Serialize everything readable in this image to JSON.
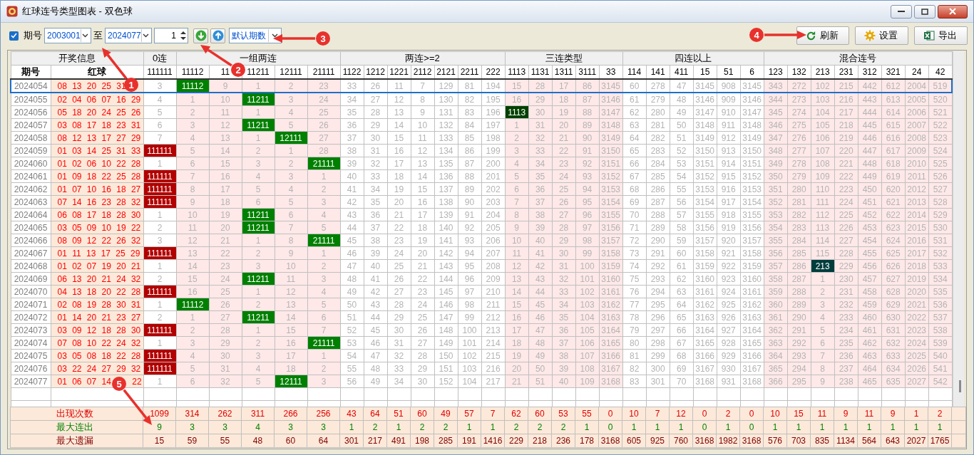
{
  "window": {
    "title": "红球连号类型图表 - 双色球"
  },
  "toolbar": {
    "range_toggle": {
      "label": "期号",
      "checked": true
    },
    "from": {
      "value": "2003001"
    },
    "to_label": "至",
    "to": {
      "value": "2024077"
    },
    "step": {
      "value": "1"
    },
    "preset": {
      "value": "默认期数"
    },
    "buttons": [
      {
        "label": "刷新",
        "kind": "refresh"
      },
      {
        "label": "设置",
        "kind": "settings"
      },
      {
        "label": "导出",
        "kind": "export"
      }
    ]
  },
  "table": {
    "info_header": {
      "title": "开奖信息",
      "columns": [
        "期号",
        "红球"
      ]
    },
    "groups": [
      {
        "title": "0连",
        "shaded": false,
        "columns": [
          "111111"
        ]
      },
      {
        "title": "一组两连",
        "shaded": true,
        "columns": [
          "11112",
          "11",
          "11211",
          "12111",
          "21111"
        ]
      },
      {
        "title": "两连>=2",
        "shaded": false,
        "columns": [
          "1122",
          "1212",
          "1221",
          "2112",
          "2121",
          "2211",
          "222"
        ]
      },
      {
        "title": "三连类型",
        "shaded": true,
        "columns": [
          "1113",
          "1131",
          "1311",
          "3111",
          "33"
        ]
      },
      {
        "title": "四连以上",
        "shaded": false,
        "columns": [
          "114",
          "141",
          "411",
          "15",
          "51",
          "6"
        ]
      },
      {
        "title": "混合连号",
        "shaded": true,
        "columns": [
          "123",
          "132",
          "213",
          "231",
          "312",
          "321",
          "24",
          "42"
        ]
      }
    ],
    "rows": [
      {
        "issue": "2024054",
        "balls": "08 13 20 25 31",
        "selected": true,
        "cells": [
          "3",
          {
            "text": "11112",
            "color": "#008000"
          },
          "9",
          "1",
          "2",
          "23",
          "33",
          "26",
          "11",
          "7",
          "129",
          "81",
          "194",
          "15",
          "28",
          "17",
          "86",
          "3145",
          "60",
          "278",
          "47",
          "3145",
          "908",
          "3145",
          "343",
          "272",
          "102",
          "215",
          "442",
          "612",
          "2004",
          "519"
        ]
      },
      {
        "issue": "2024055",
        "balls": "02 04 06 07 16 29",
        "selected": false,
        "cells": [
          "4",
          "1",
          "10",
          {
            "text": "11211",
            "color": "#008000"
          },
          "3",
          "24",
          "34",
          "27",
          "12",
          "8",
          "130",
          "82",
          "195",
          "16",
          "29",
          "18",
          "87",
          "3146",
          "61",
          "279",
          "48",
          "3146",
          "909",
          "3146",
          "344",
          "273",
          "103",
          "216",
          "443",
          "613",
          "2005",
          "520"
        ]
      },
      {
        "issue": "2024056",
        "balls": "05 18 20 24 25 26",
        "selected": false,
        "cells": [
          "5",
          "2",
          "11",
          "1",
          "4",
          "25",
          "35",
          "28",
          "13",
          "9",
          "131",
          "83",
          "196",
          {
            "text": "1113",
            "color": "#004000"
          },
          "30",
          "19",
          "88",
          "3147",
          "62",
          "280",
          "49",
          "3147",
          "910",
          "3147",
          "345",
          "274",
          "104",
          "217",
          "444",
          "614",
          "2006",
          "521"
        ]
      },
      {
        "issue": "2024057",
        "balls": "03 08 17 18 23 31",
        "selected": false,
        "cells": [
          "6",
          "3",
          "12",
          {
            "text": "11211",
            "color": "#008000"
          },
          "5",
          "26",
          "36",
          "29",
          "14",
          "10",
          "132",
          "84",
          "197",
          "1",
          "31",
          "20",
          "89",
          "3148",
          "63",
          "281",
          "50",
          "3148",
          "911",
          "3148",
          "346",
          "275",
          "105",
          "218",
          "445",
          "615",
          "2007",
          "522"
        ]
      },
      {
        "issue": "2024058",
        "balls": "08 12 13 17 27 29",
        "selected": false,
        "cells": [
          "7",
          "4",
          "13",
          "1",
          {
            "text": "12111",
            "color": "#008000"
          },
          "27",
          "37",
          "30",
          "15",
          "11",
          "133",
          "85",
          "198",
          "2",
          "32",
          "21",
          "90",
          "3149",
          "64",
          "282",
          "51",
          "3149",
          "912",
          "3149",
          "347",
          "276",
          "106",
          "219",
          "446",
          "616",
          "2008",
          "523"
        ]
      },
      {
        "issue": "2024059",
        "balls": "01 03 14 25 31 33",
        "selected": false,
        "cells": [
          {
            "text": "111111",
            "color": "#b20000"
          },
          "5",
          "14",
          "2",
          "1",
          "28",
          "38",
          "31",
          "16",
          "12",
          "134",
          "86",
          "199",
          "3",
          "33",
          "22",
          "91",
          "3150",
          "65",
          "283",
          "52",
          "3150",
          "913",
          "3150",
          "348",
          "277",
          "107",
          "220",
          "447",
          "617",
          "2009",
          "524"
        ]
      },
      {
        "issue": "2024060",
        "balls": "01 02 06 10 22 28",
        "selected": false,
        "cells": [
          "1",
          "6",
          "15",
          "3",
          "2",
          {
            "text": "21111",
            "color": "#008000"
          },
          "39",
          "32",
          "17",
          "13",
          "135",
          "87",
          "200",
          "4",
          "34",
          "23",
          "92",
          "3151",
          "66",
          "284",
          "53",
          "3151",
          "914",
          "3151",
          "349",
          "278",
          "108",
          "221",
          "448",
          "618",
          "2010",
          "525"
        ]
      },
      {
        "issue": "2024061",
        "balls": "01 09 18 22 25 28",
        "selected": false,
        "cells": [
          {
            "text": "111111",
            "color": "#b20000"
          },
          "7",
          "16",
          "4",
          "3",
          "1",
          "40",
          "33",
          "18",
          "14",
          "136",
          "88",
          "201",
          "5",
          "35",
          "24",
          "93",
          "3152",
          "67",
          "285",
          "54",
          "3152",
          "915",
          "3152",
          "350",
          "279",
          "109",
          "222",
          "449",
          "619",
          "2011",
          "526"
        ]
      },
      {
        "issue": "2024062",
        "balls": "01 07 10 16 18 27",
        "selected": false,
        "cells": [
          {
            "text": "111111",
            "color": "#b20000"
          },
          "8",
          "17",
          "5",
          "4",
          "2",
          "41",
          "34",
          "19",
          "15",
          "137",
          "89",
          "202",
          "6",
          "36",
          "25",
          "94",
          "3153",
          "68",
          "286",
          "55",
          "3153",
          "916",
          "3153",
          "351",
          "280",
          "110",
          "223",
          "450",
          "620",
          "2012",
          "527"
        ]
      },
      {
        "issue": "2024063",
        "balls": "07 14 16 23 28 32",
        "selected": false,
        "cells": [
          {
            "text": "111111",
            "color": "#b20000"
          },
          "9",
          "18",
          "6",
          "5",
          "3",
          "42",
          "35",
          "20",
          "16",
          "138",
          "90",
          "203",
          "7",
          "37",
          "26",
          "95",
          "3154",
          "69",
          "287",
          "56",
          "3154",
          "917",
          "3154",
          "352",
          "281",
          "111",
          "224",
          "451",
          "621",
          "2013",
          "528"
        ]
      },
      {
        "issue": "2024064",
        "balls": "06 08 17 18 28 30",
        "selected": false,
        "cells": [
          "1",
          "10",
          "19",
          {
            "text": "11211",
            "color": "#008000"
          },
          "6",
          "4",
          "43",
          "36",
          "21",
          "17",
          "139",
          "91",
          "204",
          "8",
          "38",
          "27",
          "96",
          "3155",
          "70",
          "288",
          "57",
          "3155",
          "918",
          "3155",
          "353",
          "282",
          "112",
          "225",
          "452",
          "622",
          "2014",
          "529"
        ]
      },
      {
        "issue": "2024065",
        "balls": "03 05 09 10 19 22",
        "selected": false,
        "cells": [
          "2",
          "11",
          "20",
          {
            "text": "11211",
            "color": "#008000"
          },
          "7",
          "5",
          "44",
          "37",
          "22",
          "18",
          "140",
          "92",
          "205",
          "9",
          "39",
          "28",
          "97",
          "3156",
          "71",
          "289",
          "58",
          "3156",
          "919",
          "3156",
          "354",
          "283",
          "113",
          "226",
          "453",
          "623",
          "2015",
          "530"
        ]
      },
      {
        "issue": "2024066",
        "balls": "08 09 12 22 26 32",
        "selected": false,
        "cells": [
          "3",
          "12",
          "21",
          "1",
          "8",
          {
            "text": "21111",
            "color": "#008000"
          },
          "45",
          "38",
          "23",
          "19",
          "141",
          "93",
          "206",
          "10",
          "40",
          "29",
          "98",
          "3157",
          "72",
          "290",
          "59",
          "3157",
          "920",
          "3157",
          "355",
          "284",
          "114",
          "227",
          "454",
          "624",
          "2016",
          "531"
        ]
      },
      {
        "issue": "2024067",
        "balls": "01 11 13 17 25 29",
        "selected": false,
        "cells": [
          {
            "text": "111111",
            "color": "#b20000"
          },
          "13",
          "22",
          "2",
          "9",
          "1",
          "46",
          "39",
          "24",
          "20",
          "142",
          "94",
          "207",
          "11",
          "41",
          "30",
          "99",
          "3158",
          "73",
          "291",
          "60",
          "3158",
          "921",
          "3158",
          "356",
          "285",
          "115",
          "228",
          "455",
          "625",
          "2017",
          "532"
        ]
      },
      {
        "issue": "2024068",
        "balls": "01 02 07 19 20 21",
        "selected": false,
        "cells": [
          "1",
          "14",
          "23",
          "3",
          "10",
          "2",
          "47",
          "40",
          "25",
          "21",
          "143",
          "95",
          "208",
          "12",
          "42",
          "31",
          "100",
          "3159",
          "74",
          "292",
          "61",
          "3159",
          "922",
          "3159",
          "357",
          "286",
          {
            "text": "213",
            "color": "#003c3c"
          },
          "229",
          "456",
          "626",
          "2018",
          "533"
        ]
      },
      {
        "issue": "2024069",
        "balls": "06 13 20 21 24 32",
        "selected": false,
        "cells": [
          "2",
          "15",
          "24",
          {
            "text": "11211",
            "color": "#008000"
          },
          "11",
          "3",
          "48",
          "41",
          "26",
          "22",
          "144",
          "96",
          "209",
          "13",
          "43",
          "32",
          "101",
          "3160",
          "75",
          "293",
          "62",
          "3160",
          "923",
          "3160",
          "358",
          "287",
          "1",
          "230",
          "457",
          "627",
          "2019",
          "534"
        ]
      },
      {
        "issue": "2024070",
        "balls": "04 13 18 20 22 28",
        "selected": false,
        "cells": [
          {
            "text": "111111",
            "color": "#b20000"
          },
          "16",
          "25",
          "1",
          "12",
          "4",
          "49",
          "42",
          "27",
          "23",
          "145",
          "97",
          "210",
          "14",
          "44",
          "33",
          "102",
          "3161",
          "76",
          "294",
          "63",
          "3161",
          "924",
          "3161",
          "359",
          "288",
          "2",
          "231",
          "458",
          "628",
          "2020",
          "535"
        ]
      },
      {
        "issue": "2024071",
        "balls": "02 08 19 28 30 31",
        "selected": false,
        "cells": [
          "1",
          {
            "text": "11112",
            "color": "#008000"
          },
          "26",
          "2",
          "13",
          "5",
          "50",
          "43",
          "28",
          "24",
          "146",
          "98",
          "211",
          "15",
          "45",
          "34",
          "103",
          "3162",
          "77",
          "295",
          "64",
          "3162",
          "925",
          "3162",
          "360",
          "289",
          "3",
          "232",
          "459",
          "629",
          "2021",
          "536"
        ]
      },
      {
        "issue": "2024072",
        "balls": "01 14 20 21 23 27",
        "selected": false,
        "cells": [
          "2",
          "1",
          "27",
          {
            "text": "11211",
            "color": "#008000"
          },
          "14",
          "6",
          "51",
          "44",
          "29",
          "25",
          "147",
          "99",
          "212",
          "16",
          "46",
          "35",
          "104",
          "3163",
          "78",
          "296",
          "65",
          "3163",
          "926",
          "3163",
          "361",
          "290",
          "4",
          "233",
          "460",
          "630",
          "2022",
          "537"
        ]
      },
      {
        "issue": "2024073",
        "balls": "03 09 12 18 28 30",
        "selected": false,
        "cells": [
          {
            "text": "111111",
            "color": "#b20000"
          },
          "2",
          "28",
          "1",
          "15",
          "7",
          "52",
          "45",
          "30",
          "26",
          "148",
          "100",
          "213",
          "17",
          "47",
          "36",
          "105",
          "3164",
          "79",
          "297",
          "66",
          "3164",
          "927",
          "3164",
          "362",
          "291",
          "5",
          "234",
          "461",
          "631",
          "2023",
          "538"
        ]
      },
      {
        "issue": "2024074",
        "balls": "07 08 10 22 24 32",
        "selected": false,
        "cells": [
          "1",
          "3",
          "29",
          "2",
          "16",
          {
            "text": "21111",
            "color": "#008000"
          },
          "53",
          "46",
          "31",
          "27",
          "149",
          "101",
          "214",
          "18",
          "48",
          "37",
          "106",
          "3165",
          "80",
          "298",
          "67",
          "3165",
          "928",
          "3165",
          "363",
          "292",
          "6",
          "235",
          "462",
          "632",
          "2024",
          "539"
        ]
      },
      {
        "issue": "2024075",
        "balls": "03 05 08 18 22 28",
        "selected": false,
        "cells": [
          {
            "text": "111111",
            "color": "#b20000"
          },
          "4",
          "30",
          "3",
          "17",
          "1",
          "54",
          "47",
          "32",
          "28",
          "150",
          "102",
          "215",
          "19",
          "49",
          "38",
          "107",
          "3166",
          "81",
          "299",
          "68",
          "3166",
          "929",
          "3166",
          "364",
          "293",
          "7",
          "236",
          "463",
          "633",
          "2025",
          "540"
        ]
      },
      {
        "issue": "2024076",
        "balls": "03 22 24 27 29 32",
        "selected": false,
        "cells": [
          {
            "text": "111111",
            "color": "#b20000"
          },
          "5",
          "31",
          "4",
          "18",
          "2",
          "55",
          "48",
          "33",
          "29",
          "151",
          "103",
          "216",
          "20",
          "50",
          "39",
          "108",
          "3167",
          "82",
          "300",
          "69",
          "3167",
          "930",
          "3167",
          "365",
          "294",
          "8",
          "237",
          "464",
          "634",
          "2026",
          "541"
        ]
      },
      {
        "issue": "2024077",
        "balls": "01 06 07 14    22",
        "selected": false,
        "cells": [
          "1",
          "6",
          "32",
          "5",
          {
            "text": "12111",
            "color": "#008000"
          },
          "3",
          "56",
          "49",
          "34",
          "30",
          "152",
          "104",
          "217",
          "21",
          "51",
          "40",
          "109",
          "3168",
          "83",
          "301",
          "70",
          "3168",
          "931",
          "3168",
          "366",
          "295",
          "9",
          "238",
          "465",
          "635",
          "2027",
          "542"
        ]
      }
    ],
    "summary": [
      {
        "label": "出现次数",
        "kind": "count",
        "values": [
          "1099",
          "314",
          "262",
          "311",
          "266",
          "256",
          "43",
          "64",
          "51",
          "60",
          "49",
          "57",
          "7",
          "62",
          "60",
          "53",
          "55",
          "0",
          "10",
          "7",
          "12",
          "0",
          "2",
          "0",
          "10",
          "15",
          "11",
          "9",
          "11",
          "9",
          "1",
          "2"
        ]
      },
      {
        "label": "最大连出",
        "kind": "streak",
        "values": [
          "9",
          "3",
          "3",
          "4",
          "3",
          "3",
          "1",
          "2",
          "1",
          "2",
          "2",
          "1",
          "1",
          "2",
          "2",
          "2",
          "1",
          "0",
          "1",
          "1",
          "1",
          "0",
          "1",
          "0",
          "1",
          "1",
          "1",
          "1",
          "1",
          "1",
          "1",
          "1"
        ]
      },
      {
        "label": "最大遗漏",
        "kind": "miss",
        "values": [
          "15",
          "59",
          "55",
          "48",
          "60",
          "64",
          "301",
          "217",
          "491",
          "198",
          "285",
          "191",
          "1416",
          "229",
          "218",
          "236",
          "178",
          "3168",
          "605",
          "925",
          "760",
          "3168",
          "1982",
          "3168",
          "576",
          "703",
          "835",
          "1134",
          "564",
          "643",
          "2027",
          "1765"
        ]
      }
    ]
  },
  "annotations": [
    {
      "label": "1"
    },
    {
      "label": "2"
    },
    {
      "label": "3"
    },
    {
      "label": "4"
    },
    {
      "label": "5"
    }
  ]
}
